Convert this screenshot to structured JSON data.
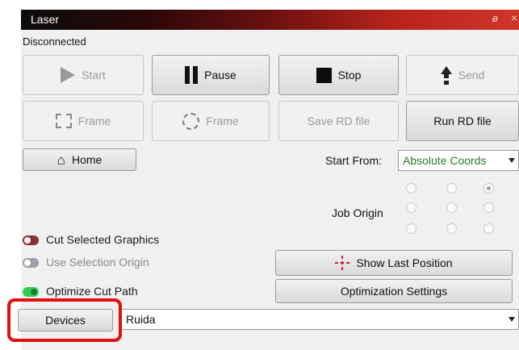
{
  "window": {
    "title": "Laser",
    "float_glyph": "ᴃ",
    "close_glyph": "×"
  },
  "status": "Disconnected",
  "toolbar": {
    "start": "Start",
    "pause": "Pause",
    "stop": "Stop",
    "send": "Send",
    "frame_rect": "Frame",
    "frame_circle": "Frame",
    "save_rd": "Save RD file",
    "run_rd": "Run RD file",
    "home": "Home"
  },
  "start_from": {
    "label": "Start From:",
    "value": "Absolute Coords"
  },
  "job_origin": {
    "label": "Job Origin",
    "selected": "top-right"
  },
  "options": {
    "cut_selected": "Cut Selected Graphics",
    "use_selection_origin": "Use Selection Origin",
    "optimize_cut_path": "Optimize Cut Path"
  },
  "actions": {
    "show_last_position": "Show Last Position",
    "optimization_settings": "Optimization Settings"
  },
  "device": {
    "button": "Devices",
    "selected": "Ruida"
  },
  "colors": {
    "accent_green": "#2a7a2a",
    "highlight_red": "#e01010",
    "toggle_on": "#2fcf55",
    "toggle_red": "#8a2c3a"
  }
}
